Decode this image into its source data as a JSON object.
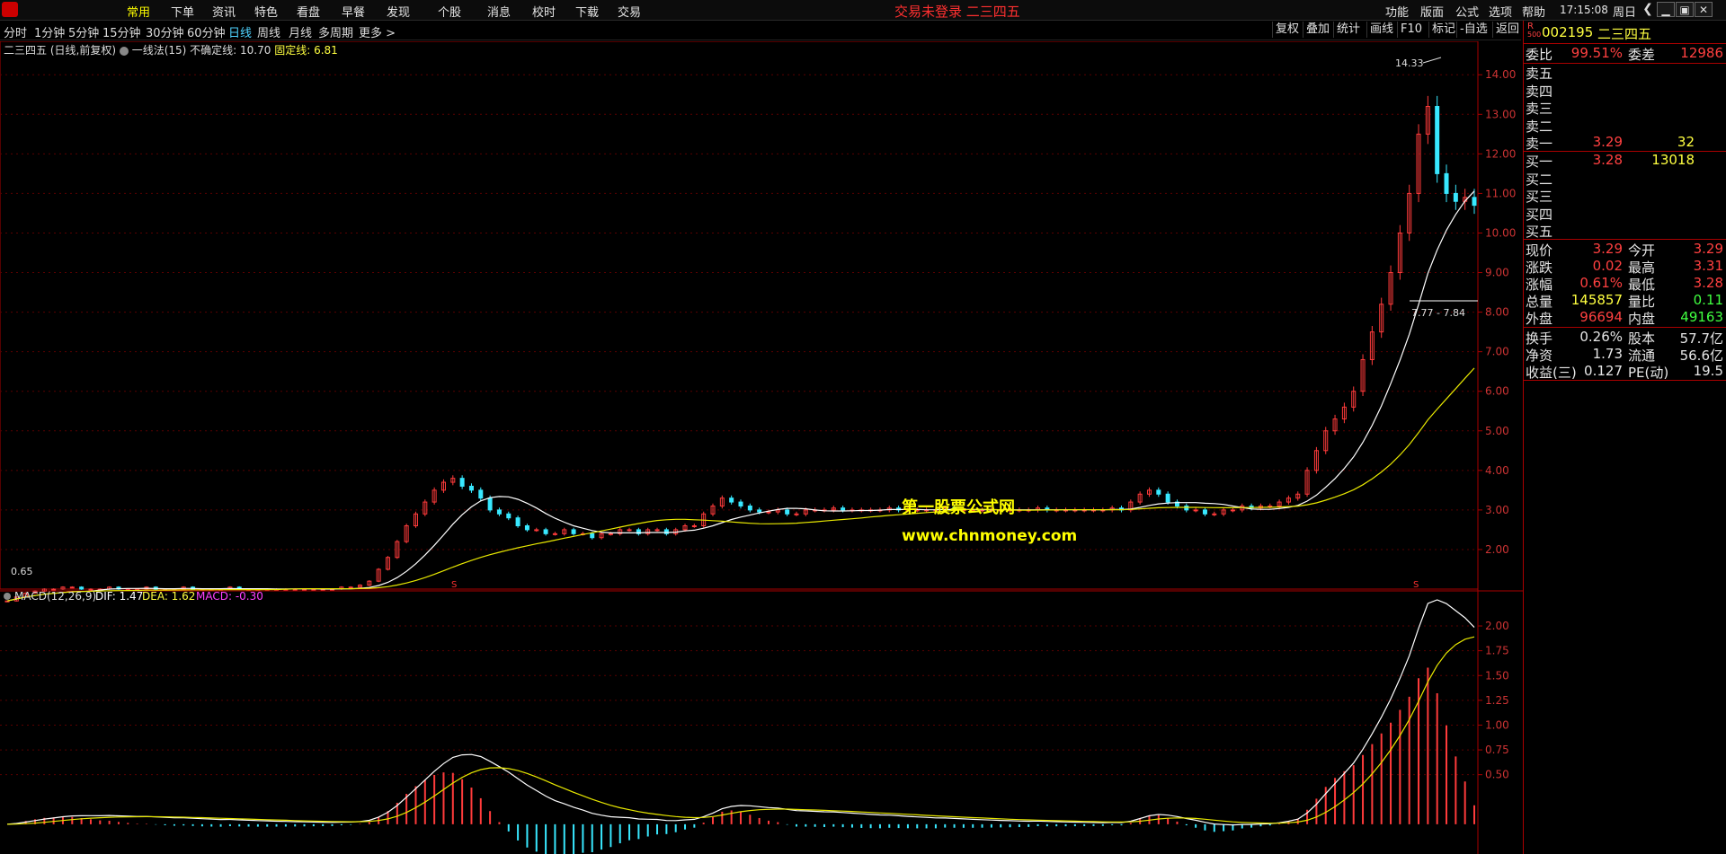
{
  "menubar": {
    "items": [
      "常用",
      "下单",
      "资讯",
      "特色",
      "看盘",
      "早餐",
      "发现",
      "个股",
      "消息",
      "校时",
      "下载",
      "交易"
    ],
    "active": "常用",
    "banner": "交易未登录   二三四五",
    "right_items": [
      "功能",
      "版面",
      "公式",
      "选项",
      "帮助"
    ],
    "time": "17:15:08",
    "weekday": "周日"
  },
  "periodbar": {
    "items": [
      "分时",
      "1分钟",
      "5分钟",
      "15分钟",
      "30分钟",
      "60分钟",
      "日线",
      "周线",
      "月线",
      "多周期",
      "更多 >"
    ],
    "active": "日线",
    "tools": [
      "复权",
      "叠加",
      "统计",
      "画线",
      "F10",
      "标记",
      "-自选",
      "返回"
    ]
  },
  "info": {
    "stock": "二三四五",
    "mode": "(日线,前复权)",
    "indicator": "一线法(15)",
    "uncertain_label": "不确定线:",
    "uncertain_value": "10.70",
    "fixed_label": "固定线:",
    "fixed_value": "6.81"
  },
  "price_axis": [
    "14.00",
    "13.00",
    "12.00",
    "11.00",
    "10.00",
    "9.00",
    "8.00",
    "7.00",
    "6.00",
    "5.00",
    "4.00",
    "3.00",
    "2.00"
  ],
  "annotations": {
    "high": "14.33",
    "low": "0.65",
    "range": "7.77 - 7.84",
    "marker": "S"
  },
  "macd": {
    "label": "MACD(12,26,9)",
    "dif_label": "DIF: 1.47",
    "dea_label": "DEA: 1.62",
    "macd_label": "MACD: -0.30",
    "axis": [
      "2.00",
      "1.75",
      "1.50",
      "1.25",
      "1.00",
      "0.75",
      "0.50"
    ]
  },
  "watermark": {
    "line1": "第一股票公式网",
    "line2": "www.chnmoney.com"
  },
  "quote": {
    "r_badge": "R",
    "r_sub": "500",
    "code": "002195",
    "name": "二三四五",
    "weibi_label": "委比",
    "weibi": "99.51%",
    "weicha_label": "委差",
    "weicha": "12986",
    "sells": [
      {
        "label": "卖五",
        "price": "",
        "vol": ""
      },
      {
        "label": "卖四",
        "price": "",
        "vol": ""
      },
      {
        "label": "卖三",
        "price": "",
        "vol": ""
      },
      {
        "label": "卖二",
        "price": "",
        "vol": ""
      },
      {
        "label": "卖一",
        "price": "3.29",
        "vol": "32"
      }
    ],
    "buys": [
      {
        "label": "买一",
        "price": "3.28",
        "vol": "13018"
      },
      {
        "label": "买二",
        "price": "",
        "vol": ""
      },
      {
        "label": "买三",
        "price": "",
        "vol": ""
      },
      {
        "label": "买四",
        "price": "",
        "vol": ""
      },
      {
        "label": "买五",
        "price": "",
        "vol": ""
      }
    ],
    "stats": [
      {
        "l1": "现价",
        "v1": "3.29",
        "l2": "今开",
        "v2": "3.29",
        "c1": "#ff4040",
        "c2": "#ff4040"
      },
      {
        "l1": "涨跌",
        "v1": "0.02",
        "l2": "最高",
        "v2": "3.31",
        "c1": "#ff4040",
        "c2": "#ff4040"
      },
      {
        "l1": "涨幅",
        "v1": "0.61%",
        "l2": "最低",
        "v2": "3.28",
        "c1": "#ff4040",
        "c2": "#ff4040"
      },
      {
        "l1": "总量",
        "v1": "145857",
        "l2": "量比",
        "v2": "0.11",
        "c1": "#ffff40",
        "c2": "#40ff40"
      },
      {
        "l1": "外盘",
        "v1": "96694",
        "l2": "内盘",
        "v2": "49163",
        "c1": "#ff4040",
        "c2": "#40ff40"
      }
    ],
    "fund": [
      {
        "l1": "换手",
        "v1": "0.26%",
        "l2": "股本",
        "v2": "57.7亿"
      },
      {
        "l1": "净资",
        "v1": "1.73",
        "l2": "流通",
        "v2": "56.6亿"
      },
      {
        "l1": "收益(三)",
        "v1": "0.127",
        "l2": "PE(动)",
        "v2": "19.5"
      }
    ]
  },
  "chart_data": [
    {
      "type": "candlestick",
      "title": "二三四五 (日线,前复权)",
      "ylim": [
        1.0,
        14.8
      ],
      "close_approx": [
        0.7,
        0.8,
        0.9,
        0.95,
        1.0,
        1.0,
        1.05,
        1.05,
        1.0,
        1.0,
        1.0,
        1.05,
        1.0,
        1.0,
        1.0,
        1.05,
        1.0,
        1.0,
        1.0,
        1.05,
        1.0,
        1.0,
        1.0,
        1.0,
        1.05,
        1.0,
        1.0,
        1.0,
        1.0,
        1.0,
        1.0,
        1.0,
        1.0,
        1.0,
        1.0,
        1.0,
        1.05,
        1.05,
        1.1,
        1.2,
        1.5,
        1.8,
        2.2,
        2.6,
        2.9,
        3.2,
        3.5,
        3.7,
        3.8,
        3.6,
        3.5,
        3.3,
        3.0,
        2.9,
        2.8,
        2.6,
        2.5,
        2.5,
        2.4,
        2.4,
        2.5,
        2.4,
        2.4,
        2.3,
        2.4,
        2.4,
        2.5,
        2.5,
        2.4,
        2.5,
        2.5,
        2.4,
        2.5,
        2.6,
        2.6,
        2.9,
        3.1,
        3.3,
        3.2,
        3.1,
        3.0,
        2.95,
        2.95,
        3.0,
        2.9,
        2.9,
        3.0,
        3.0,
        3.0,
        3.05,
        3.0,
        3.0,
        3.0,
        3.0,
        3.0,
        3.05,
        3.0,
        3.0,
        3.0,
        3.0,
        3.0,
        3.05,
        3.0,
        3.0,
        3.0,
        3.0,
        3.0,
        3.0,
        3.0,
        3.0,
        3.0,
        3.05,
        3.0,
        3.0,
        3.0,
        3.0,
        3.0,
        3.0,
        3.0,
        3.05,
        3.0,
        3.2,
        3.4,
        3.5,
        3.4,
        3.2,
        3.1,
        3.0,
        3.0,
        2.9,
        2.9,
        3.0,
        3.0,
        3.1,
        3.05,
        3.1,
        3.1,
        3.2,
        3.3,
        3.4,
        4.0,
        4.5,
        5.0,
        5.3,
        5.6,
        6.0,
        6.8,
        7.5,
        8.2,
        9.0,
        10.0,
        11.0,
        12.5,
        13.2,
        11.5,
        11.0,
        10.8,
        10.9,
        10.7
      ],
      "annotations": {
        "high": 14.33,
        "low": 0.65,
        "fixed_line": 6.81,
        "uncertain_line": 10.7
      }
    },
    {
      "type": "line",
      "title": "MACD(12,26,9)",
      "ylim": [
        -0.3,
        2.1
      ],
      "series": [
        {
          "name": "DIF",
          "last": 1.47
        },
        {
          "name": "DEA",
          "last": 1.62
        },
        {
          "name": "MACD",
          "last": -0.3
        }
      ]
    }
  ]
}
